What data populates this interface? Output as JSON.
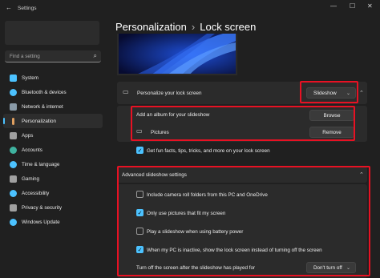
{
  "window": {
    "app_title": "Settings"
  },
  "search": {
    "placeholder": "Find a setting"
  },
  "nav": {
    "items": [
      {
        "label": "System",
        "icon": "monitor-icon",
        "color": "#4cc2ff"
      },
      {
        "label": "Bluetooth & devices",
        "icon": "bluetooth-icon",
        "color": "#4cc2ff"
      },
      {
        "label": "Network & internet",
        "icon": "wifi-icon",
        "color": "#8a9ba8"
      },
      {
        "label": "Personalization",
        "icon": "brush-icon",
        "color": "#e0a060"
      },
      {
        "label": "Apps",
        "icon": "apps-icon",
        "color": "#a0a0a0"
      },
      {
        "label": "Accounts",
        "icon": "person-icon",
        "color": "#3fb3a0"
      },
      {
        "label": "Time & language",
        "icon": "globe-icon",
        "color": "#4cc2ff"
      },
      {
        "label": "Gaming",
        "icon": "gamepad-icon",
        "color": "#a0a0a0"
      },
      {
        "label": "Accessibility",
        "icon": "accessibility-icon",
        "color": "#4cc2ff"
      },
      {
        "label": "Privacy & security",
        "icon": "shield-icon",
        "color": "#a0a0a0"
      },
      {
        "label": "Windows Update",
        "icon": "update-icon",
        "color": "#4cc2ff"
      }
    ],
    "active_index": 3
  },
  "header": {
    "section": "Personalization",
    "page": "Lock screen",
    "separator": "›"
  },
  "lockscreen": {
    "label": "Personalize your lock screen",
    "dropdown_value": "Slideshow"
  },
  "album": {
    "add_label": "Add an album for your slideshow",
    "browse_label": "Browse",
    "folder_name": "Pictures",
    "remove_label": "Remove"
  },
  "fun_facts": {
    "label": "Get fun facts, tips, tricks, and more on your lock screen",
    "checked": true
  },
  "advanced": {
    "title": "Advanced slideshow settings",
    "options": [
      {
        "label": "Include camera roll folders from this PC and OneDrive",
        "checked": false
      },
      {
        "label": "Only use pictures that fit my screen",
        "checked": true
      },
      {
        "label": "Play a slideshow when using battery power",
        "checked": false
      },
      {
        "label": "When my PC is inactive, show the lock screen instead of turning off the screen",
        "checked": true
      }
    ],
    "turn_off_label": "Turn off the screen after the slideshow has played for",
    "turn_off_value": "Don't turn off"
  },
  "colors": {
    "accent": "#4cc2ff",
    "highlight": "#e81123"
  }
}
